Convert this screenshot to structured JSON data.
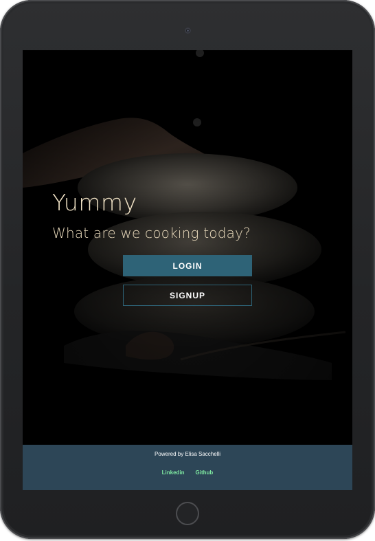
{
  "hero": {
    "title": "Yummy",
    "tagline": "What are we cooking today?",
    "login_label": "LOGIN",
    "signup_label": "SIGNUP"
  },
  "footer": {
    "credit": "Powered by Elisa Sacchelli",
    "links": [
      "Linkedin",
      "Github"
    ]
  },
  "colors": {
    "accent": "#2e6377",
    "footer_bg": "#2d4657",
    "link": "#7ee8a0",
    "title_text": "#f1e3c6"
  },
  "icons": {
    "camera": "front-camera-icon",
    "home": "home-button-icon"
  }
}
